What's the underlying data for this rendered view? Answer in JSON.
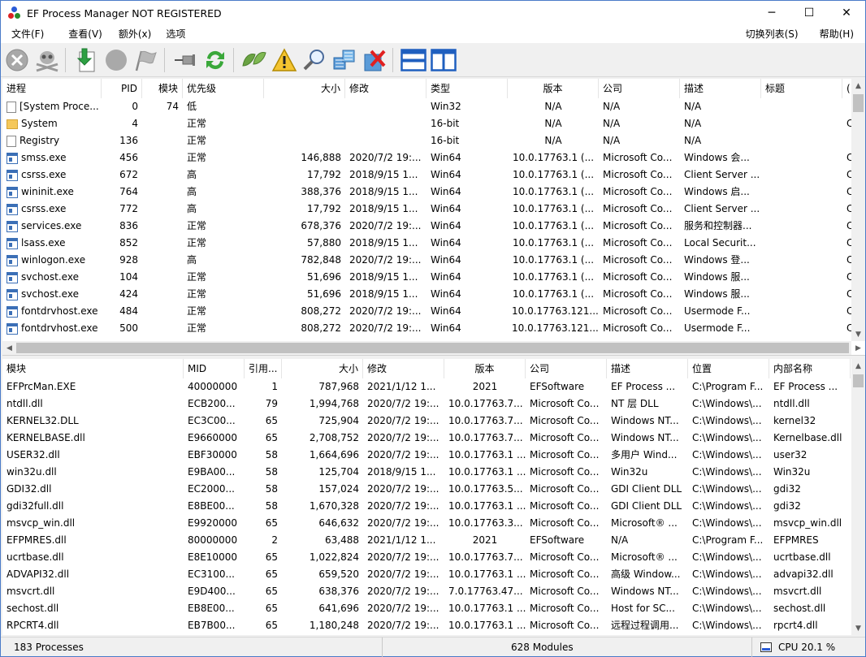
{
  "window": {
    "title": "EF Process Manager NOT REGISTERED",
    "controls": {
      "minimize": "─",
      "maximize": "☐",
      "close": "✕"
    }
  },
  "menu": {
    "left": [
      "文件(F)",
      "查看(V)",
      "额外(x)",
      "选项"
    ],
    "right": [
      "切换列表(S)",
      "帮助(H)"
    ]
  },
  "toolbar": {
    "buttons": [
      "close-process-icon",
      "kill-process-icon",
      "export-icon",
      "stop-icon",
      "flag-icon",
      "pin-icon",
      "refresh-icon",
      "leaf-icon",
      "warning-icon",
      "search-icon",
      "dependencies-icon",
      "remove-icon",
      "horizontal-layout-icon",
      "vertical-layout-icon"
    ]
  },
  "processes": {
    "columns": [
      "进程",
      "PID",
      "模块",
      "优先级",
      "大小",
      "修改",
      "类型",
      "版本",
      "公司",
      "描述",
      "标题",
      "("
    ],
    "rows": [
      {
        "icon": "doc",
        "name": "[System Proce...",
        "pid": "0",
        "modules": "74",
        "priority": "低",
        "size": "",
        "modified": "",
        "type": "Win32",
        "version": "N/A",
        "company": "N/A",
        "desc": "N/A",
        "title": "",
        "extra": ""
      },
      {
        "icon": "folder",
        "name": "System",
        "pid": "4",
        "modules": "",
        "priority": "正常",
        "size": "",
        "modified": "",
        "type": "16-bit",
        "version": "N/A",
        "company": "N/A",
        "desc": "N/A",
        "title": "",
        "extra": "C"
      },
      {
        "icon": "doc",
        "name": "Registry",
        "pid": "136",
        "modules": "",
        "priority": "正常",
        "size": "",
        "modified": "",
        "type": "16-bit",
        "version": "N/A",
        "company": "N/A",
        "desc": "N/A",
        "title": "",
        "extra": ""
      },
      {
        "icon": "exe",
        "name": "smss.exe",
        "pid": "456",
        "modules": "",
        "priority": "正常",
        "size": "146,888",
        "modified": "2020/7/2 19:...",
        "type": "Win64",
        "version": "10.0.17763.1 (...",
        "company": "Microsoft Co...",
        "desc": "Windows 会...",
        "title": "",
        "extra": "C"
      },
      {
        "icon": "exe",
        "name": "csrss.exe",
        "pid": "672",
        "modules": "",
        "priority": "高",
        "size": "17,792",
        "modified": "2018/9/15 1...",
        "type": "Win64",
        "version": "10.0.17763.1 (...",
        "company": "Microsoft Co...",
        "desc": "Client Server ...",
        "title": "",
        "extra": "C"
      },
      {
        "icon": "exe",
        "name": "wininit.exe",
        "pid": "764",
        "modules": "",
        "priority": "高",
        "size": "388,376",
        "modified": "2018/9/15 1...",
        "type": "Win64",
        "version": "10.0.17763.1 (...",
        "company": "Microsoft Co...",
        "desc": "Windows 启...",
        "title": "",
        "extra": "C"
      },
      {
        "icon": "exe",
        "name": "csrss.exe",
        "pid": "772",
        "modules": "",
        "priority": "高",
        "size": "17,792",
        "modified": "2018/9/15 1...",
        "type": "Win64",
        "version": "10.0.17763.1 (...",
        "company": "Microsoft Co...",
        "desc": "Client Server ...",
        "title": "",
        "extra": "C"
      },
      {
        "icon": "exe",
        "name": "services.exe",
        "pid": "836",
        "modules": "",
        "priority": "正常",
        "size": "678,376",
        "modified": "2020/7/2 19:...",
        "type": "Win64",
        "version": "10.0.17763.1 (...",
        "company": "Microsoft Co...",
        "desc": "服务和控制器...",
        "title": "",
        "extra": "C"
      },
      {
        "icon": "exe",
        "name": "lsass.exe",
        "pid": "852",
        "modules": "",
        "priority": "正常",
        "size": "57,880",
        "modified": "2018/9/15 1...",
        "type": "Win64",
        "version": "10.0.17763.1 (...",
        "company": "Microsoft Co...",
        "desc": "Local Securit...",
        "title": "",
        "extra": "C"
      },
      {
        "icon": "exe",
        "name": "winlogon.exe",
        "pid": "928",
        "modules": "",
        "priority": "高",
        "size": "782,848",
        "modified": "2020/7/2 19:...",
        "type": "Win64",
        "version": "10.0.17763.1 (...",
        "company": "Microsoft Co...",
        "desc": "Windows 登...",
        "title": "",
        "extra": "C"
      },
      {
        "icon": "exe",
        "name": "svchost.exe",
        "pid": "104",
        "modules": "",
        "priority": "正常",
        "size": "51,696",
        "modified": "2018/9/15 1...",
        "type": "Win64",
        "version": "10.0.17763.1 (...",
        "company": "Microsoft Co...",
        "desc": "Windows 服...",
        "title": "",
        "extra": "C"
      },
      {
        "icon": "exe",
        "name": "svchost.exe",
        "pid": "424",
        "modules": "",
        "priority": "正常",
        "size": "51,696",
        "modified": "2018/9/15 1...",
        "type": "Win64",
        "version": "10.0.17763.1 (...",
        "company": "Microsoft Co...",
        "desc": "Windows 服...",
        "title": "",
        "extra": "C"
      },
      {
        "icon": "exe",
        "name": "fontdrvhost.exe",
        "pid": "484",
        "modules": "",
        "priority": "正常",
        "size": "808,272",
        "modified": "2020/7/2 19:...",
        "type": "Win64",
        "version": "10.0.17763.121...",
        "company": "Microsoft Co...",
        "desc": "Usermode F...",
        "title": "",
        "extra": "C"
      },
      {
        "icon": "exe",
        "name": "fontdrvhost.exe",
        "pid": "500",
        "modules": "",
        "priority": "正常",
        "size": "808,272",
        "modified": "2020/7/2 19:...",
        "type": "Win64",
        "version": "10.0.17763.121...",
        "company": "Microsoft Co...",
        "desc": "Usermode F...",
        "title": "",
        "extra": "C"
      }
    ]
  },
  "modules": {
    "columns": [
      "模块",
      "MID",
      "引用...",
      "大小",
      "修改",
      "版本",
      "公司",
      "描述",
      "位置",
      "内部名称"
    ],
    "rows": [
      {
        "name": "EFPrcMan.EXE",
        "mid": "40000000",
        "refs": "1",
        "size": "787,968",
        "modified": "2021/1/12 1...",
        "version": "2021",
        "company": "EFSoftware",
        "desc": "EF Process ...",
        "location": "C:\\Program F...",
        "internal": "EF Process ..."
      },
      {
        "name": "ntdll.dll",
        "mid": "ECB200...",
        "refs": "79",
        "size": "1,994,768",
        "modified": "2020/7/2 19:...",
        "version": "10.0.17763.7...",
        "company": "Microsoft Co...",
        "desc": "NT 层 DLL",
        "location": "C:\\Windows\\...",
        "internal": "ntdll.dll"
      },
      {
        "name": "KERNEL32.DLL",
        "mid": "EC3C00...",
        "refs": "65",
        "size": "725,904",
        "modified": "2020/7/2 19:...",
        "version": "10.0.17763.7...",
        "company": "Microsoft Co...",
        "desc": "Windows NT...",
        "location": "C:\\Windows\\...",
        "internal": "kernel32"
      },
      {
        "name": "KERNELBASE.dll",
        "mid": "E9660000",
        "refs": "65",
        "size": "2,708,752",
        "modified": "2020/7/2 19:...",
        "version": "10.0.17763.7...",
        "company": "Microsoft Co...",
        "desc": "Windows NT...",
        "location": "C:\\Windows\\...",
        "internal": "Kernelbase.dll"
      },
      {
        "name": "USER32.dll",
        "mid": "EBF30000",
        "refs": "58",
        "size": "1,664,696",
        "modified": "2020/7/2 19:...",
        "version": "10.0.17763.1 ...",
        "company": "Microsoft Co...",
        "desc": "多用户 Wind...",
        "location": "C:\\Windows\\...",
        "internal": "user32"
      },
      {
        "name": "win32u.dll",
        "mid": "E9BA00...",
        "refs": "58",
        "size": "125,704",
        "modified": "2018/9/15 1...",
        "version": "10.0.17763.1 ...",
        "company": "Microsoft Co...",
        "desc": "Win32u",
        "location": "C:\\Windows\\...",
        "internal": "Win32u"
      },
      {
        "name": "GDI32.dll",
        "mid": "EC2000...",
        "refs": "58",
        "size": "157,024",
        "modified": "2020/7/2 19:...",
        "version": "10.0.17763.5...",
        "company": "Microsoft Co...",
        "desc": "GDI Client DLL",
        "location": "C:\\Windows\\...",
        "internal": "gdi32"
      },
      {
        "name": "gdi32full.dll",
        "mid": "E8BE00...",
        "refs": "58",
        "size": "1,670,328",
        "modified": "2020/7/2 19:...",
        "version": "10.0.17763.1 ...",
        "company": "Microsoft Co...",
        "desc": "GDI Client DLL",
        "location": "C:\\Windows\\...",
        "internal": "gdi32"
      },
      {
        "name": "msvcp_win.dll",
        "mid": "E9920000",
        "refs": "65",
        "size": "646,632",
        "modified": "2020/7/2 19:...",
        "version": "10.0.17763.3...",
        "company": "Microsoft Co...",
        "desc": "Microsoft® ...",
        "location": "C:\\Windows\\...",
        "internal": "msvcp_win.dll"
      },
      {
        "name": "EFPMRES.dll",
        "mid": "80000000",
        "refs": "2",
        "size": "63,488",
        "modified": "2021/1/12 1...",
        "version": "2021",
        "company": "EFSoftware",
        "desc": "N/A",
        "location": "C:\\Program F...",
        "internal": "EFPMRES"
      },
      {
        "name": "ucrtbase.dll",
        "mid": "E8E10000",
        "refs": "65",
        "size": "1,022,824",
        "modified": "2020/7/2 19:...",
        "version": "10.0.17763.7...",
        "company": "Microsoft Co...",
        "desc": "Microsoft® ...",
        "location": "C:\\Windows\\...",
        "internal": "ucrtbase.dll"
      },
      {
        "name": "ADVAPI32.dll",
        "mid": "EC3100...",
        "refs": "65",
        "size": "659,520",
        "modified": "2020/7/2 19:...",
        "version": "10.0.17763.1 ...",
        "company": "Microsoft Co...",
        "desc": "高级 Window...",
        "location": "C:\\Windows\\...",
        "internal": "advapi32.dll"
      },
      {
        "name": "msvcrt.dll",
        "mid": "E9D400...",
        "refs": "65",
        "size": "638,376",
        "modified": "2020/7/2 19:...",
        "version": "7.0.17763.47...",
        "company": "Microsoft Co...",
        "desc": "Windows NT...",
        "location": "C:\\Windows\\...",
        "internal": "msvcrt.dll"
      },
      {
        "name": "sechost.dll",
        "mid": "EB8E00...",
        "refs": "65",
        "size": "641,696",
        "modified": "2020/7/2 19:...",
        "version": "10.0.17763.1 ...",
        "company": "Microsoft Co...",
        "desc": "Host for SC...",
        "location": "C:\\Windows\\...",
        "internal": "sechost.dll"
      },
      {
        "name": "RPCRT4.dll",
        "mid": "EB7B00...",
        "refs": "65",
        "size": "1,180,248",
        "modified": "2020/7/2 19:...",
        "version": "10.0.17763.1 ...",
        "company": "Microsoft Co...",
        "desc": "远程过程调用...",
        "location": "C:\\Windows\\...",
        "internal": "rpcrt4.dll"
      }
    ]
  },
  "status": {
    "processes": "183 Processes",
    "modules": "628 Modules",
    "cpu": "CPU 20.1 %"
  }
}
